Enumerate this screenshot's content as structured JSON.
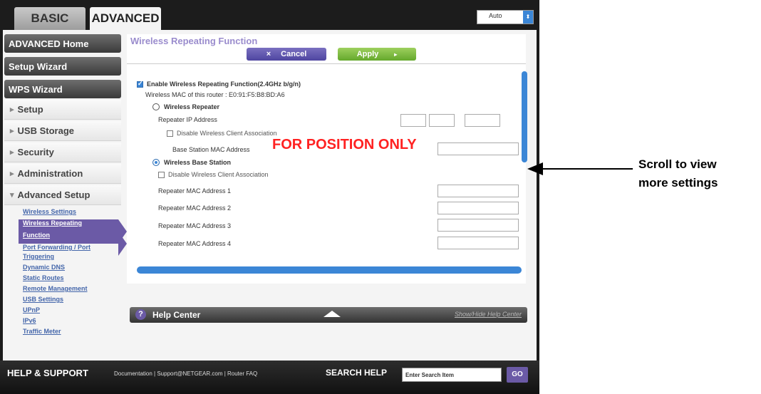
{
  "tabs": {
    "basic": "BASIC",
    "advanced": "ADVANCED"
  },
  "language": {
    "value": "Auto"
  },
  "sidebar": {
    "buttons": [
      "ADVANCED Home",
      "Setup Wizard",
      "WPS Wizard"
    ],
    "sections": [
      "Setup",
      "USB Storage",
      "Security",
      "Administration",
      "Advanced Setup"
    ],
    "sublinks": [
      "Wireless Settings",
      "Wireless Repeating",
      "Function",
      "Port Forwarding / Port",
      "Triggering",
      "Dynamic DNS",
      "Static Routes",
      "Remote Management",
      "USB Settings",
      "UPnP",
      "IPv6",
      "Traffic Meter"
    ]
  },
  "content": {
    "title": "Wireless Repeating Function",
    "cancel": "Cancel",
    "apply": "Apply",
    "enable_24": "Enable Wireless Repeating Function(2.4GHz b/g/n)",
    "mac_label": "Wireless MAC of this router : E0:91:F5:B8:BD:A6",
    "wireless_repeater": "Wireless Repeater",
    "repeater_ip": "Repeater IP Address",
    "disable_assoc_1": "Disable Wireless Client Association",
    "base_station_mac": "Base Station MAC Address",
    "wireless_base_station": "Wireless Base Station",
    "disable_assoc_2": "Disable Wireless Client Association",
    "repeater_mac_1": "Repeater MAC Address 1",
    "repeater_mac_2": "Repeater MAC Address 2",
    "repeater_mac_3": "Repeater MAC Address 3",
    "repeater_mac_4": "Repeater MAC Address 4",
    "fpo": "FOR POSITION ONLY"
  },
  "help": {
    "title": "Help Center",
    "toggle": "Show/Hide Help Center"
  },
  "footer": {
    "title": "HELP & SUPPORT",
    "links": "Documentation | Support@NETGEAR.com | Router FAQ",
    "search_label": "SEARCH HELP",
    "search_placeholder": "Enter Search Item",
    "go": "GO"
  },
  "annotation": {
    "line1": "Scroll to view",
    "line2": "more settings"
  },
  "colors": {
    "accent": "#3b86d6",
    "purple": "#6b5aa6",
    "green": "#64a82c",
    "fpo_red": "#ff2222"
  }
}
